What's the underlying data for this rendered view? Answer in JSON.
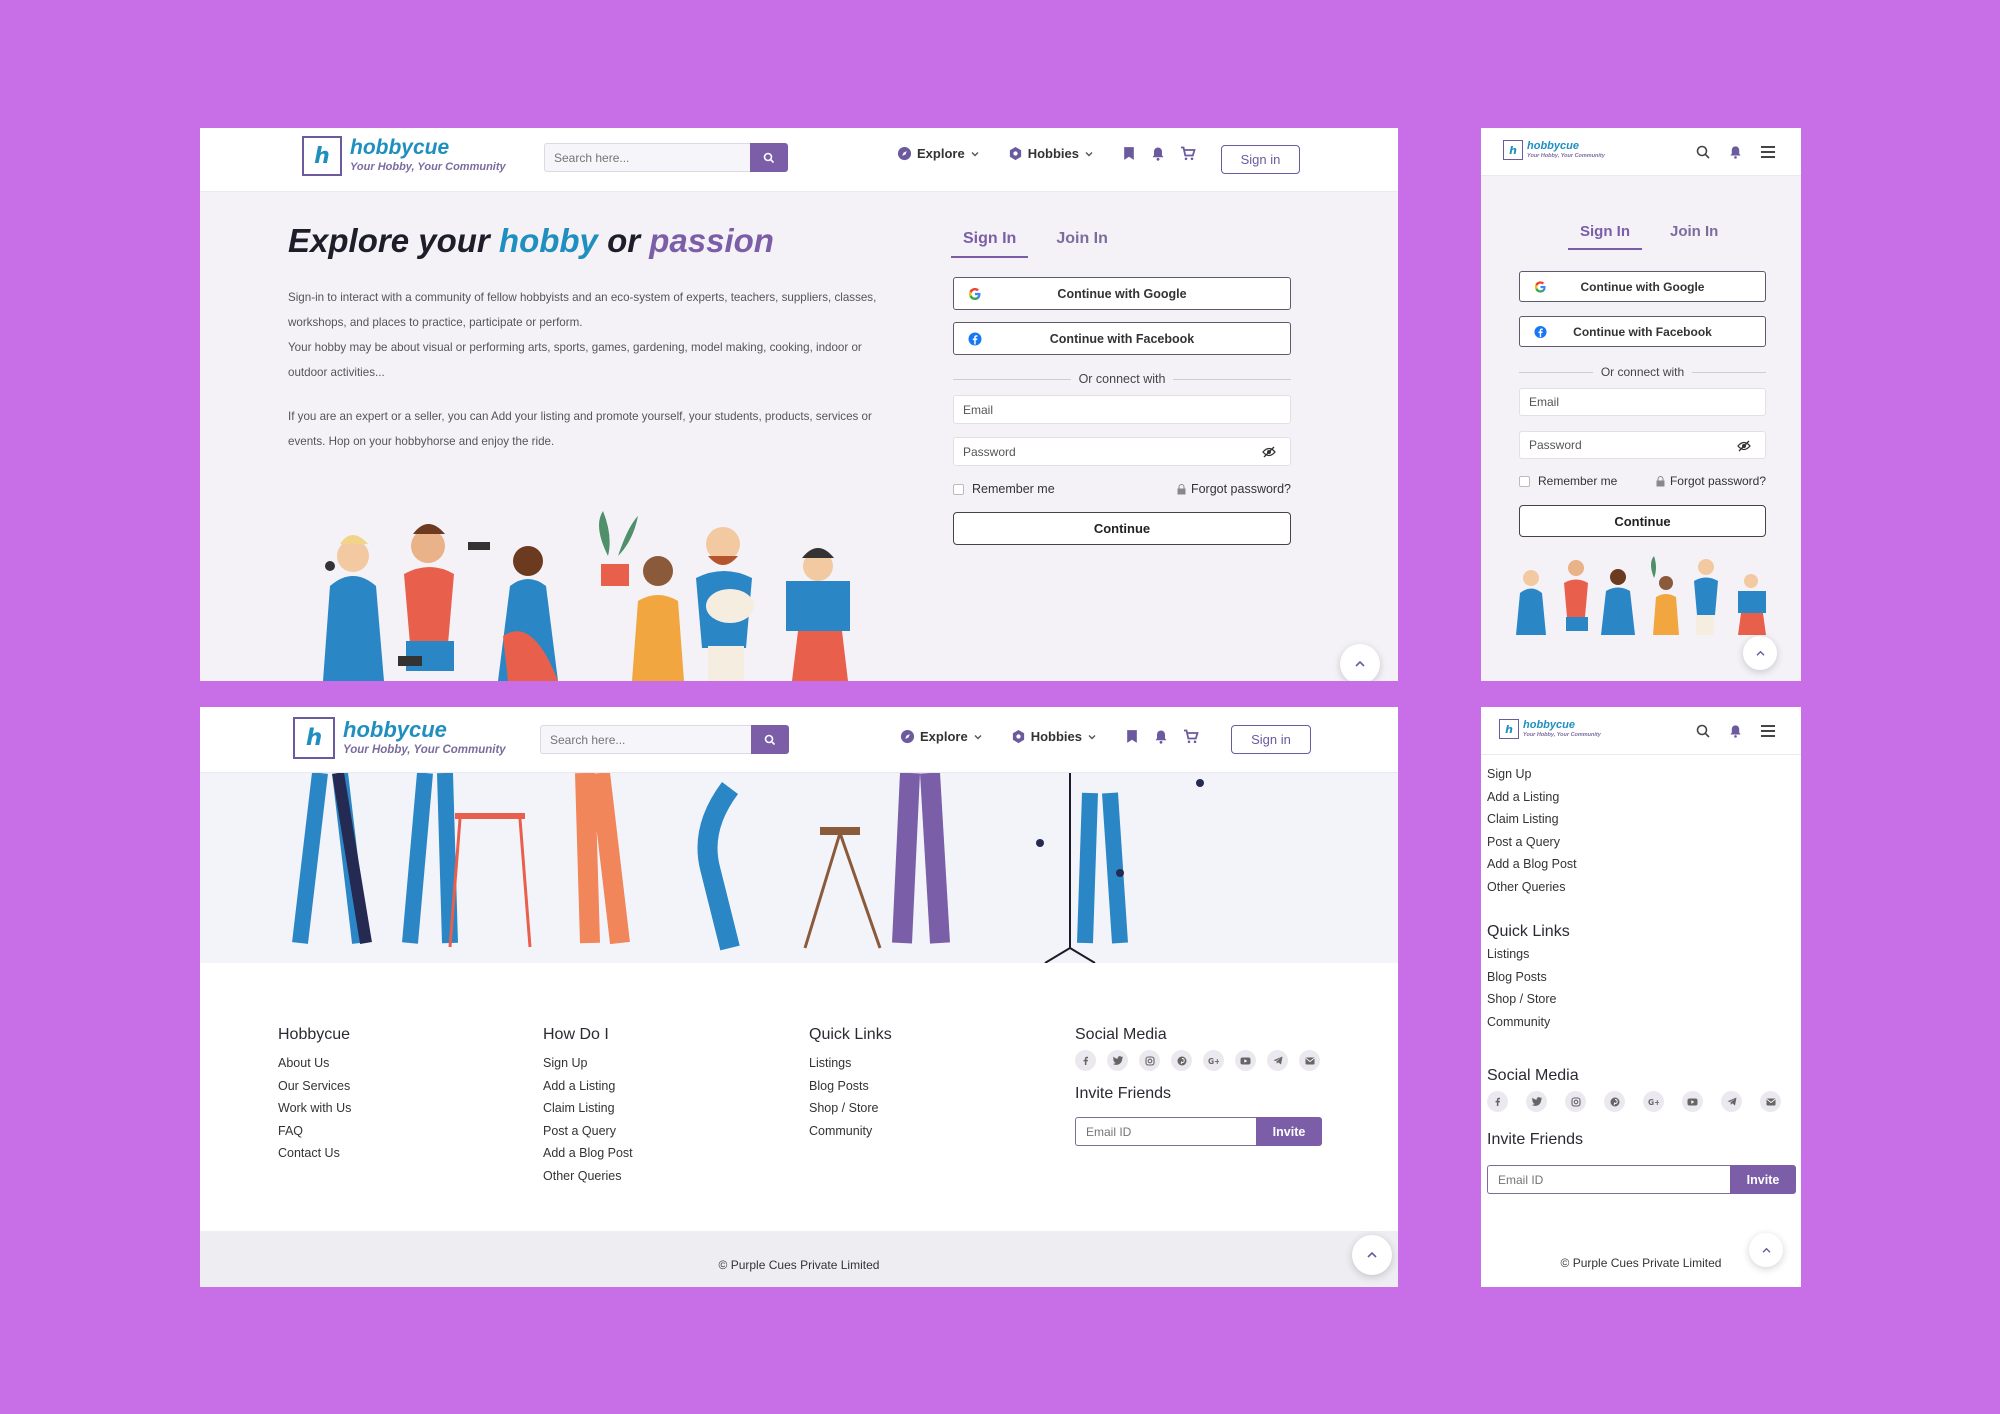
{
  "brand": {
    "name": "hobbycue",
    "tagline": "Your Hobby, Your Community",
    "logo_letter": "h",
    "colors": {
      "purple": "#7b5ea7",
      "blue": "#1f8fbf",
      "background": "#c86ee6"
    }
  },
  "nav": {
    "search_placeholder": "Search here...",
    "explore": "Explore",
    "hobbies": "Hobbies",
    "signin": "Sign in",
    "icons": [
      "search-icon",
      "bookmark-icon",
      "bell-icon",
      "cart-icon",
      "menu-icon"
    ]
  },
  "hero": {
    "title_pre": "Explore your",
    "title_hobby": "hobby",
    "title_or": "or",
    "title_passion": "passion",
    "p1": "Sign-in to interact with a community of fellow hobbyists and an eco-system of experts, teachers, suppliers, classes, workshops, and places to practice, participate or perform.",
    "p2": "Your hobby may be about visual or performing arts, sports, games, gardening, model making, cooking, indoor or outdoor activities...",
    "p3": "If you are an expert or a seller, you can Add your listing and promote yourself, your students, products, services or events. Hop on your hobbyhorse and enjoy the ride."
  },
  "auth": {
    "tab_signin": "Sign In",
    "tab_join": "Join In",
    "google": "Continue with Google",
    "facebook": "Continue with Facebook",
    "or_connect": "Or connect with",
    "email_placeholder": "Email",
    "password_placeholder": "Password",
    "remember": "Remember me",
    "forgot": "Forgot password?",
    "continue": "Continue"
  },
  "footer": {
    "col1": {
      "title": "Hobbycue",
      "links": [
        "About Us",
        "Our Services",
        "Work with Us",
        "FAQ",
        "Contact Us"
      ]
    },
    "col2": {
      "title": "How Do I",
      "links": [
        "Sign Up",
        "Add a Listing",
        "Claim Listing",
        "Post a Query",
        "Add a Blog Post",
        "Other Queries"
      ]
    },
    "col3": {
      "title": "Quick Links",
      "links": [
        "Listings",
        "Blog Posts",
        "Shop / Store",
        "Community"
      ]
    },
    "social_title": "Social Media",
    "social_icons": [
      "facebook-icon",
      "twitter-icon",
      "instagram-icon",
      "pinterest-icon",
      "google-plus-icon",
      "youtube-icon",
      "telegram-icon",
      "mail-icon"
    ],
    "invite_title": "Invite Friends",
    "invite_placeholder": "Email ID",
    "invite_button": "Invite",
    "copyright": "© Purple Cues Private Limited"
  }
}
